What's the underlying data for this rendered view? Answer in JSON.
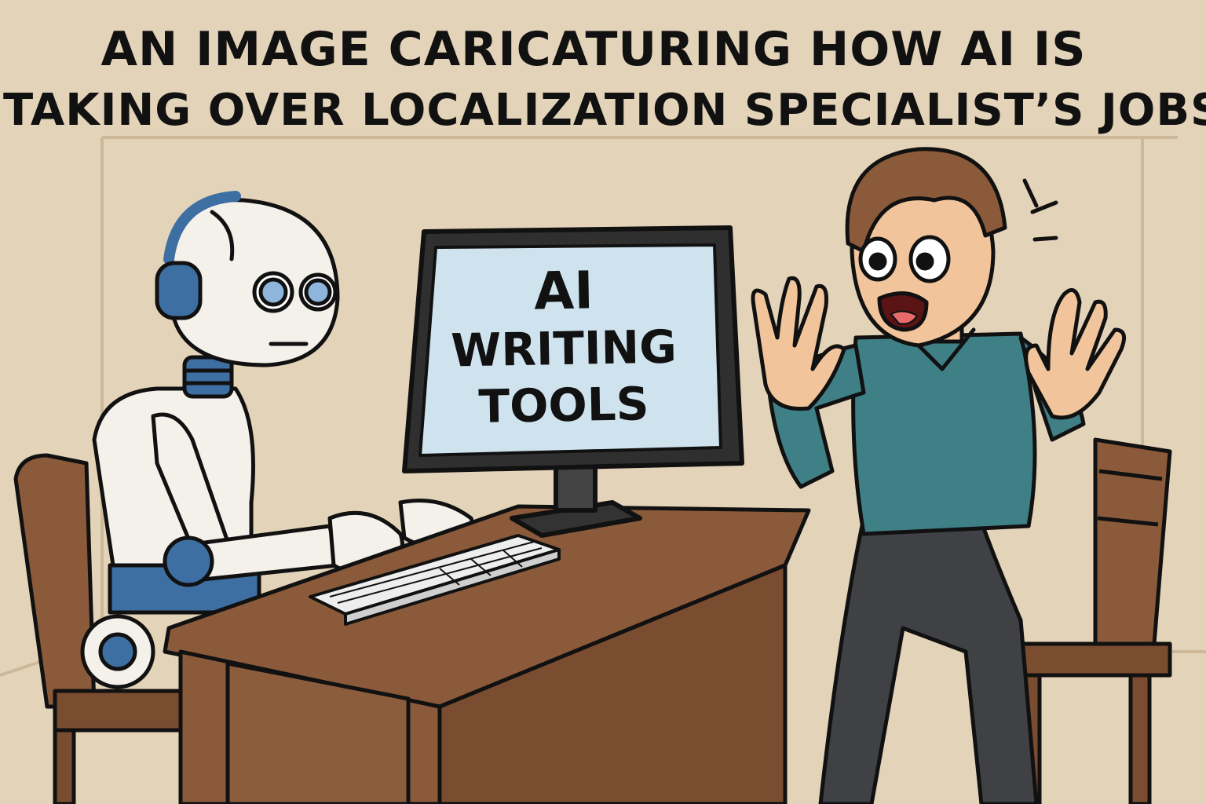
{
  "caption": {
    "line1": "AN IMAGE CARICATURING HOW AI IS",
    "line2": "TAKING OVER LOCALIZATION SPECIALIST’S JOBS"
  },
  "monitor_screen": {
    "line1": "AI",
    "line2": "WRITING",
    "line3": "TOOLS"
  },
  "colors": {
    "wall": "#e3d3b8",
    "wood": "#8a5a3a",
    "shirt": "#3f7f86",
    "pants": "#3f4144",
    "robot_accent": "#3e6fa3",
    "screen": "#cfe3ee"
  }
}
